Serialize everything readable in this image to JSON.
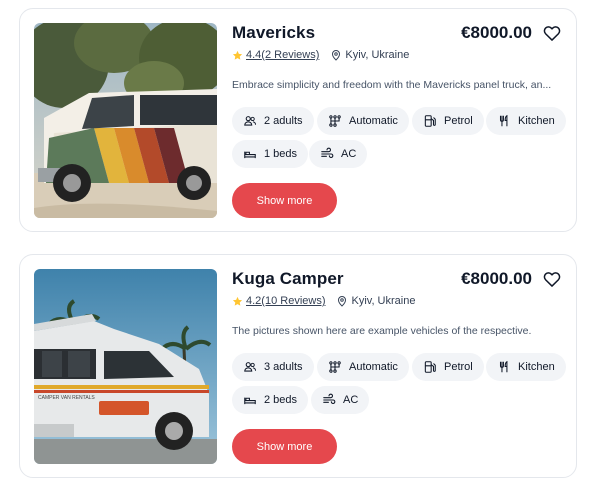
{
  "listings": [
    {
      "title": "Mavericks",
      "price": "€8000.00",
      "rating": "4.4",
      "reviews": "(2 Reviews)",
      "location": "Kyiv, Ukraine",
      "description": "Embrace simplicity and freedom with the Mavericks panel truck, an...",
      "features": {
        "adults": "2 adults",
        "transmission": "Automatic",
        "fuel": "Petrol",
        "kitchen": "Kitchen",
        "beds": "1 beds",
        "ac": "AC"
      },
      "button": "Show more"
    },
    {
      "title": "Kuga Camper",
      "price": "€8000.00",
      "rating": "4.2",
      "reviews": "(10 Reviews)",
      "location": "Kyiv, Ukraine",
      "description": "The pictures shown here are example vehicles of the respective.",
      "features": {
        "adults": "3 adults",
        "transmission": "Automatic",
        "fuel": "Petrol",
        "kitchen": "Kitchen",
        "beds": "2 beds",
        "ac": "AC"
      },
      "button": "Show more"
    }
  ],
  "colors": {
    "accent": "#e5484d",
    "star": "#ffc531",
    "chip_bg": "#f2f4f7",
    "border": "#e4e7ec"
  },
  "icons": [
    "heart-icon",
    "star-icon",
    "map-pin-icon",
    "users-icon",
    "transmission-icon",
    "fuel-icon",
    "kitchen-icon",
    "bed-icon",
    "wind-icon"
  ]
}
